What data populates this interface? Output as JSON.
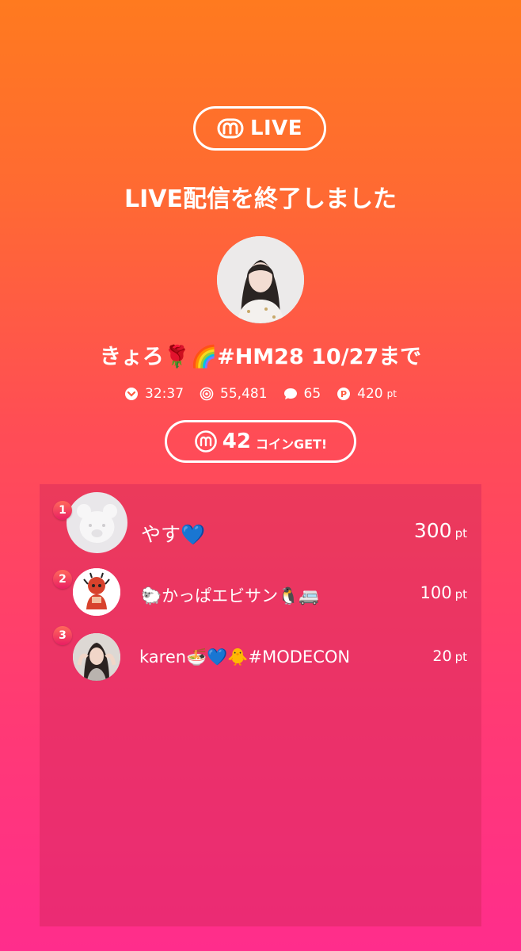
{
  "brand": {
    "logo_icon": "m-logo-icon",
    "label": "LIVE"
  },
  "headline": "LIVE配信を終了しました",
  "host": {
    "name": "きょろ🌹🌈#HM28 10/27まで",
    "avatar_icon": "host-avatar"
  },
  "stats": {
    "duration": "32:37",
    "views": "55,481",
    "comments": "65",
    "points": "420",
    "points_unit": "pt"
  },
  "coins": {
    "amount": "42",
    "label": "コインGET!"
  },
  "ranking": [
    {
      "rank": "1",
      "name": "やす💙",
      "points": "300",
      "unit": "pt"
    },
    {
      "rank": "2",
      "name": "🐑かっぱエビサン🐧🚐",
      "points": "100",
      "unit": "pt"
    },
    {
      "rank": "3",
      "name": "karen🍜💙🐥#MODECON",
      "points": "20",
      "unit": "pt"
    }
  ],
  "colors": {
    "bg_top": "#ff7a1f",
    "bg_bottom": "#ff2d8c",
    "rank_badge": "#e91e63"
  }
}
